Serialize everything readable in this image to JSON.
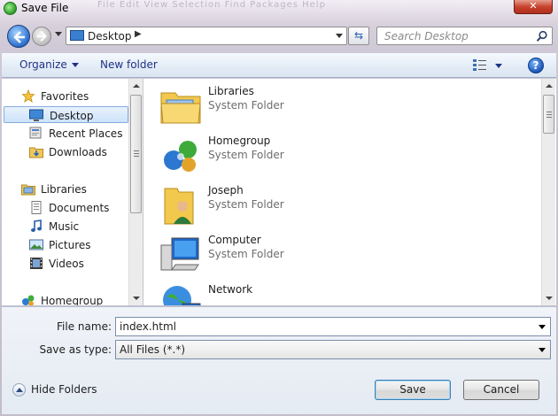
{
  "window": {
    "title": "Save File",
    "close_label": "✕",
    "background_menu": "File  Edit  View  Selection  Find  Packages  Help"
  },
  "address_bar": {
    "location": "Desktop",
    "search_placeholder": "Search Desktop"
  },
  "toolbar": {
    "organize_label": "Organize",
    "new_folder_label": "New folder",
    "help_label": "?"
  },
  "nav": {
    "favorites": {
      "label": "Favorites",
      "items": [
        {
          "label": "Desktop",
          "icon": "desktop-icon",
          "selected": true
        },
        {
          "label": "Recent Places",
          "icon": "recent-places-icon"
        },
        {
          "label": "Downloads",
          "icon": "downloads-icon"
        }
      ]
    },
    "libraries": {
      "label": "Libraries",
      "items": [
        {
          "label": "Documents",
          "icon": "documents-icon"
        },
        {
          "label": "Music",
          "icon": "music-icon"
        },
        {
          "label": "Pictures",
          "icon": "pictures-icon"
        },
        {
          "label": "Videos",
          "icon": "videos-icon"
        }
      ]
    },
    "homegroup": {
      "label": "Homegroup"
    }
  },
  "files": [
    {
      "name": "Libraries",
      "type": "System Folder",
      "icon": "libraries-folder-icon"
    },
    {
      "name": "Homegroup",
      "type": "System Folder",
      "icon": "homegroup-icon"
    },
    {
      "name": "Joseph",
      "type": "System Folder",
      "icon": "user-folder-icon"
    },
    {
      "name": "Computer",
      "type": "System Folder",
      "icon": "computer-icon"
    },
    {
      "name": "Network",
      "type": "",
      "icon": "network-icon"
    }
  ],
  "form": {
    "file_name_label": "File name:",
    "file_name_value": "index.html",
    "save_as_type_label": "Save as type:",
    "save_as_type_value": "All Files (*.*)",
    "hide_folders_label": "Hide Folders",
    "save_label": "Save",
    "cancel_label": "Cancel"
  }
}
